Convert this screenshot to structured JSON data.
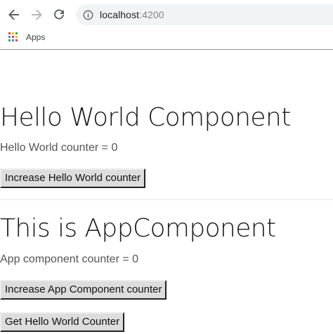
{
  "browser": {
    "url_host": "localhost",
    "url_port": ":4200",
    "bookmarks": [
      {
        "label": "Apps",
        "icon": "apps-grid-icon"
      }
    ]
  },
  "hello_world_component": {
    "title": "Hello World Component",
    "counter_text": "Hello World counter = 0",
    "button_label": "Increase Hello World counter"
  },
  "app_component": {
    "title": "This is AppComponent",
    "counter_text": "App component counter = 0",
    "increase_button_label": "Increase App Component counter",
    "get_button_label": "Get Hello World Counter"
  },
  "colors": {
    "omnibox_bg": "#f1f3f4",
    "nav_icon": "#5f6368",
    "button_bg": "#dddddd",
    "apps_icon_colors": [
      "#ea4335",
      "#fbbc04",
      "#34a853",
      "#4285f4",
      "#ea4335",
      "#fbbc04",
      "#34a853",
      "#4285f4",
      "#ea4335"
    ]
  }
}
